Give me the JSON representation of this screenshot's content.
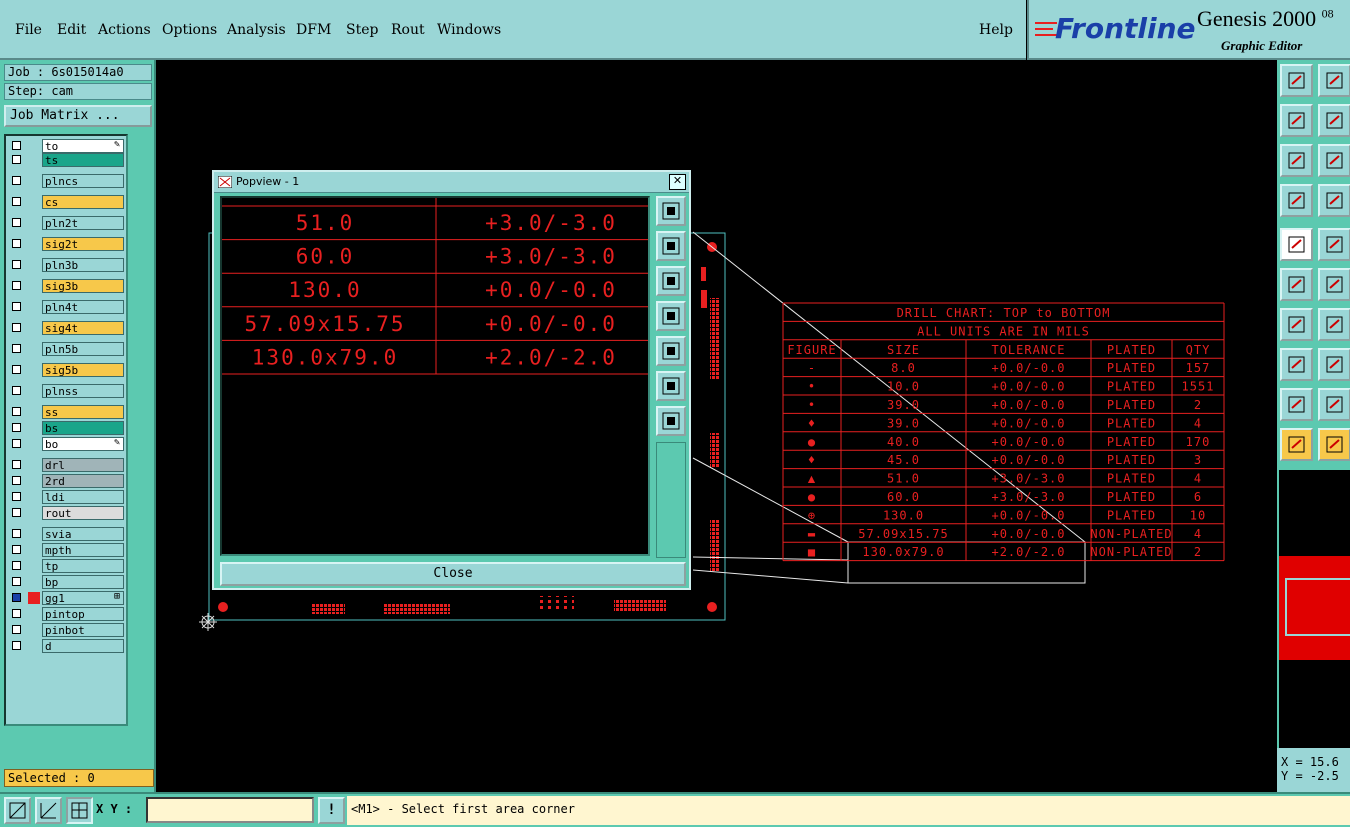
{
  "menu": {
    "items": [
      "File",
      "Edit",
      "Actions",
      "Options",
      "Analysis",
      "DFM",
      "Step",
      "Rout",
      "Windows"
    ],
    "help": "Help"
  },
  "logo": {
    "brand": "Frontline",
    "product": "Genesis 2000",
    "version": "08",
    "subtitle": "Graphic Editor"
  },
  "job": {
    "job_label": "Job : 6s015014a0",
    "step_label": "Step: cam",
    "matrix_button": "Job Matrix ..."
  },
  "layers": [
    {
      "name": "to",
      "color": "#ffffff",
      "edit": true
    },
    {
      "name": "ts",
      "color": "#1aa58a",
      "edit": false
    },
    {
      "name": "plncs",
      "color": "#9ad6d6",
      "edit": false
    },
    {
      "name": "cs",
      "color": "#f7c84a",
      "edit": false
    },
    {
      "name": "pln2t",
      "color": "#9ad6d6",
      "edit": false
    },
    {
      "name": "sig2t",
      "color": "#f7c84a",
      "edit": false
    },
    {
      "name": "pln3b",
      "color": "#9ad6d6",
      "edit": false
    },
    {
      "name": "sig3b",
      "color": "#f7c84a",
      "edit": false
    },
    {
      "name": "pln4t",
      "color": "#9ad6d6",
      "edit": false
    },
    {
      "name": "sig4t",
      "color": "#f7c84a",
      "edit": false
    },
    {
      "name": "pln5b",
      "color": "#9ad6d6",
      "edit": false
    },
    {
      "name": "sig5b",
      "color": "#f7c84a",
      "edit": false
    },
    {
      "name": "plnss",
      "color": "#9ad6d6",
      "edit": false
    },
    {
      "name": "ss",
      "color": "#f7c84a",
      "edit": false
    },
    {
      "name": "bs",
      "color": "#1aa58a",
      "edit": false
    },
    {
      "name": "bo",
      "color": "#ffffff",
      "edit": true
    },
    {
      "name": "drl",
      "color": "#a0b4b8",
      "edit": false
    },
    {
      "name": "2rd",
      "color": "#a0b4b8",
      "edit": false
    },
    {
      "name": "ldi",
      "color": "#9ad6d6",
      "edit": false
    },
    {
      "name": "rout",
      "color": "#dcdcdc",
      "edit": false
    },
    {
      "name": "svia",
      "color": "#9ad6d6",
      "edit": false
    },
    {
      "name": "mpth",
      "color": "#9ad6d6",
      "edit": false
    },
    {
      "name": "tp",
      "color": "#9ad6d6",
      "edit": false
    },
    {
      "name": "bp",
      "color": "#9ad6d6",
      "edit": false
    },
    {
      "name": "gg1",
      "color": "#9ad6d6",
      "edit": false,
      "active": true
    },
    {
      "name": "pintop",
      "color": "#9ad6d6",
      "edit": false
    },
    {
      "name": "pinbot",
      "color": "#9ad6d6",
      "edit": false
    },
    {
      "name": "d",
      "color": "#9ad6d6",
      "edit": false
    }
  ],
  "selected": "Selected : 0",
  "coords": {
    "x": "X = 15.6",
    "y": "Y = -2.5"
  },
  "bottom": {
    "xy_label": "X Y :",
    "xy_value": "",
    "alert": "!",
    "status": "<M1> - Select first area corner"
  },
  "popview": {
    "title": "Popview - 1",
    "close_label": "Close",
    "rows": [
      {
        "size": "51.0",
        "tol": "+3.0/-3.0"
      },
      {
        "size": "60.0",
        "tol": "+3.0/-3.0"
      },
      {
        "size": "130.0",
        "tol": "+0.0/-0.0"
      },
      {
        "size": "57.09x15.75",
        "tol": "+0.0/-0.0"
      },
      {
        "size": "130.0x79.0",
        "tol": "+2.0/-2.0"
      }
    ]
  },
  "drill_chart": {
    "title": "DRILL CHART: TOP to BOTTOM",
    "subtitle": "ALL UNITS ARE IN MILS",
    "headers": [
      "FIGURE",
      "SIZE",
      "TOLERANCE",
      "PLATED",
      "QTY"
    ],
    "rows": [
      {
        "fig": "-",
        "size": "8.0",
        "tol": "+0.0/-0.0",
        "plated": "PLATED",
        "qty": "157"
      },
      {
        "fig": "•",
        "size": "10.0",
        "tol": "+0.0/-0.0",
        "plated": "PLATED",
        "qty": "1551"
      },
      {
        "fig": "•",
        "size": "39.0",
        "tol": "+0.0/-0.0",
        "plated": "PLATED",
        "qty": "2"
      },
      {
        "fig": "♦",
        "size": "39.0",
        "tol": "+0.0/-0.0",
        "plated": "PLATED",
        "qty": "4"
      },
      {
        "fig": "●",
        "size": "40.0",
        "tol": "+0.0/-0.0",
        "plated": "PLATED",
        "qty": "170"
      },
      {
        "fig": "♦",
        "size": "45.0",
        "tol": "+0.0/-0.0",
        "plated": "PLATED",
        "qty": "3"
      },
      {
        "fig": "▲",
        "size": "51.0",
        "tol": "+3.0/-3.0",
        "plated": "PLATED",
        "qty": "4"
      },
      {
        "fig": "●",
        "size": "60.0",
        "tol": "+3.0/-3.0",
        "plated": "PLATED",
        "qty": "6"
      },
      {
        "fig": "⊕",
        "size": "130.0",
        "tol": "+0.0/-0.0",
        "plated": "PLATED",
        "qty": "10"
      },
      {
        "fig": "▬",
        "size": "57.09x15.75",
        "tol": "+0.0/-0.0",
        "plated": "NON-PLATED",
        "qty": "4"
      },
      {
        "fig": "■",
        "size": "130.0x79.0",
        "tol": "+2.0/-2.0",
        "plated": "NON-PLATED",
        "qty": "2"
      }
    ]
  },
  "colors": {
    "accent": "#9ad6d6",
    "panel": "#5cc9b0",
    "drawing": "#e82020",
    "selection": "#f7c84a"
  },
  "icons": {
    "toolbar": [
      "zoom-top-icon",
      "zoom-bottom-icon",
      "pan-left-icon",
      "pan-right-icon",
      "fit-all-icon",
      "fit-profile-icon",
      "measure-icon",
      "grid-icon",
      "feature-select-icon",
      "net-select-icon",
      "snap-node-icon",
      "cross-icon",
      "line-add-icon",
      "arc-add-icon",
      "pad-add-icon",
      "surface-add-icon",
      "polygon-add-icon",
      "polygon-edit-icon",
      "pointer-icon",
      "pointer-select-icon"
    ],
    "popview": [
      "zoom-window-icon",
      "pan-up-icon",
      "pan-down-icon",
      "pan-left-icon",
      "pan-right-icon",
      "zoom-out-icon",
      "zoom-in-icon"
    ],
    "bottom": [
      "zoom-area-icon",
      "measure-icon",
      "snap-grid-icon"
    ]
  }
}
